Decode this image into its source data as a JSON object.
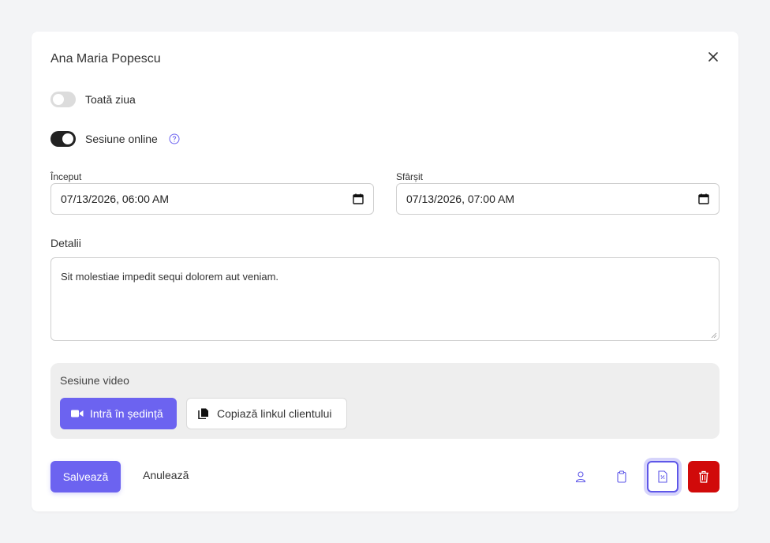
{
  "dialog": {
    "title": "Ana Maria Popescu"
  },
  "toggles": {
    "all_day": {
      "label": "Toată ziua",
      "checked": false
    },
    "online_session": {
      "label": "Sesiune online",
      "checked": true
    }
  },
  "fields": {
    "start": {
      "label": "Început",
      "value": "07/13/2026, 06:00 AM"
    },
    "end": {
      "label": "Sfârșit",
      "value": "07/13/2026, 07:00 AM"
    },
    "details": {
      "label": "Detalii",
      "value": "Sit molestiae impedit sequi dolorem aut veniam."
    }
  },
  "video_session": {
    "title": "Sesiune video",
    "join_label": "Intră în ședință",
    "copy_label": "Copiază linkul clientului"
  },
  "actions": {
    "save_label": "Salvează",
    "cancel_label": "Anulează",
    "icons": [
      "person-icon",
      "clipboard-icon",
      "invoice-icon",
      "trash-icon"
    ]
  },
  "colors": {
    "primary": "#6c63f0",
    "danger": "#d10a0a",
    "toggle_on": "#222222",
    "toggle_off": "#dcdcdc",
    "background": "#f3f4f6"
  }
}
